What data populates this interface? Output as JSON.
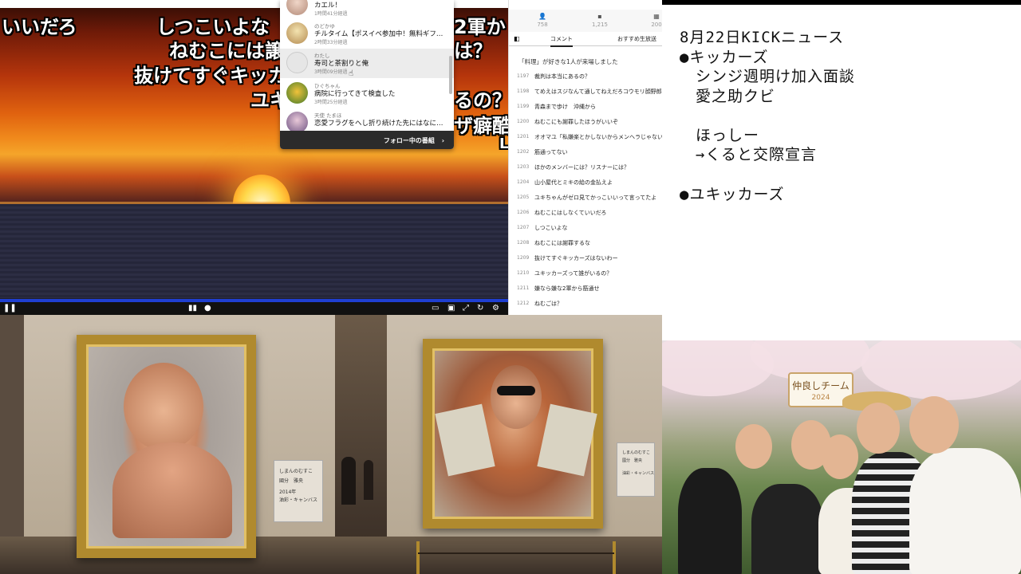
{
  "video": {
    "overlay_comments": [
      "いいだろ",
      "しつこいよな",
      "2軍か",
      "ねむこには譲",
      "は？",
      "抜けてすぐキッカ",
      "ユキ",
      "るの？",
      "ザ癖酷",
      "L"
    ]
  },
  "notifications": {
    "items": [
      {
        "user": "",
        "title": "カエル！",
        "time": "1時間41分経過"
      },
      {
        "user": "のどかゆ",
        "title": "チルタイム【ポスイベ参加中！無料ギフ…",
        "time": "2時間33分経過"
      },
      {
        "user": "わたし",
        "title": "寿司と茶割りと俺",
        "time": "3時間09分経過"
      },
      {
        "user": "ひぐちゃん",
        "title": "病院に行ってきて検査した",
        "time": "3時間25分経過"
      },
      {
        "user": "天使 たまほ",
        "title": "恋愛フラグをへし折り続けた先にはなに…",
        "time": ""
      }
    ],
    "footer_label": "フォロー中の番組",
    "footer_chevron": "›"
  },
  "comment_panel": {
    "stats": [
      {
        "icon": "viewer-icon",
        "value": "758"
      },
      {
        "icon": "comment-icon",
        "value": "1,215"
      },
      {
        "icon": "ad-icon",
        "value": "200"
      }
    ],
    "tabs": [
      "コメント",
      "おすすめ生放送"
    ],
    "system_message": "「料理」が好きな1人が来場しました",
    "comments": [
      {
        "no": "1197",
        "text": "裁判は本当にあるの？"
      },
      {
        "no": "1198",
        "text": "てめえはスジなんて通してねえだろコウモリ顔野郎"
      },
      {
        "no": "1199",
        "text": "青森まで歩け　沖縄から"
      },
      {
        "no": "1200",
        "text": "ねむこにも謝罪したほうがいいぞ"
      },
      {
        "no": "1201",
        "text": "オオマユ「私嫌楽とかしないからメンヘラじゃない"
      },
      {
        "no": "1202",
        "text": "筋通ってない"
      },
      {
        "no": "1203",
        "text": "ほかのメンバーには？リスナーには？"
      },
      {
        "no": "1204",
        "text": "山小屋代とミキの給の金払えよ"
      },
      {
        "no": "1205",
        "text": "ユキちゃんがゼロ見てかっこいいって言ってたよ"
      },
      {
        "no": "1206",
        "text": "ねむこにはしなくていいだろ"
      },
      {
        "no": "1207",
        "text": "しつこいよな"
      },
      {
        "no": "1208",
        "text": "ねむこには謝罪するな"
      },
      {
        "no": "1209",
        "text": "抜けてすぐキッカーズはないわー"
      },
      {
        "no": "1210",
        "text": "ユキッカーズって誰がいるの？"
      },
      {
        "no": "1211",
        "text": "嫌なら嫌な2軍から筋通せ"
      },
      {
        "no": "1212",
        "text": "ねむごは？"
      }
    ]
  },
  "notes": {
    "lines": [
      "8月22日KICKニュース",
      "●キッカーズ",
      "　シンジ週明け加入面談",
      "　愛之助クビ",
      "",
      "　ほっしー",
      "　→くると交際宣言",
      "",
      "●ユキッカーズ"
    ]
  },
  "museum": {
    "placard_left": [
      "しまんのむすこ",
      "國分　雅央",
      "2014年",
      "油彩・キャンバス"
    ],
    "placard_right": [
      "しまんのむすこ",
      "國分　雅央",
      "",
      "油彩・キャンバス"
    ]
  },
  "park": {
    "sign_line1": "仲良しチーム",
    "sign_line2": "2024"
  }
}
